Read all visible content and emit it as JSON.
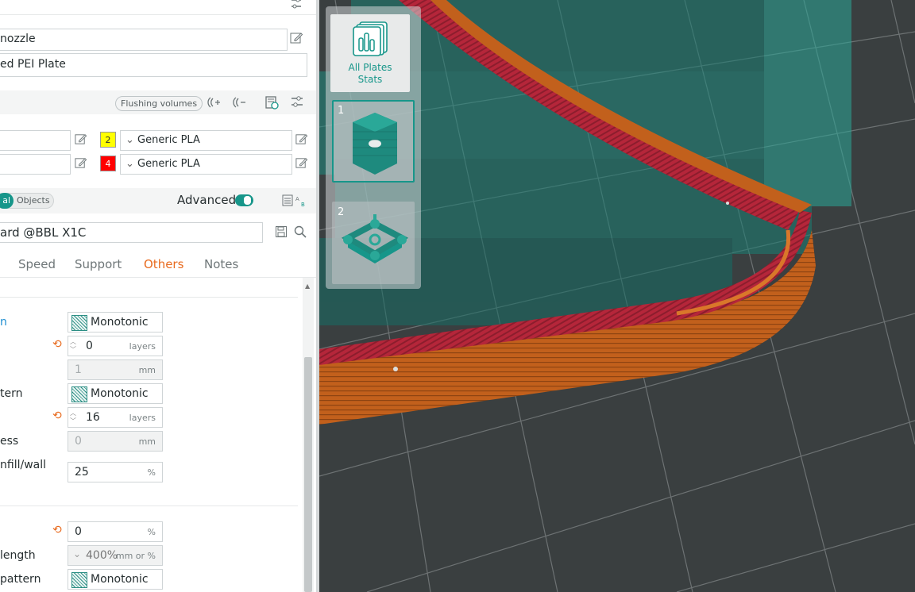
{
  "printer": {
    "nozzle_text": " nozzle",
    "plate_text": "ed PEI Plate"
  },
  "filament_header": {
    "flushing_volumes_label": "Flushing volumes"
  },
  "filaments": [
    {
      "index": "2",
      "color": "#ffff00",
      "name": "Generic PLA"
    },
    {
      "index": "4",
      "color": "#ff0000",
      "name": "Generic PLA"
    }
  ],
  "process": {
    "global_label": "al",
    "objects_label": "Objects",
    "advanced_label": "Advanced",
    "preset_name": "ard @BBL X1C"
  },
  "tabs": [
    {
      "label": "Speed",
      "active": false
    },
    {
      "label": "Support",
      "active": false
    },
    {
      "label": "Others",
      "active": true
    },
    {
      "label": "Notes",
      "active": false
    }
  ],
  "settings": {
    "top_pattern": {
      "label": "n",
      "value": "Monotonic ..."
    },
    "top_layers": {
      "value": "0",
      "unit": "layers"
    },
    "top_thickness": {
      "value": "1",
      "unit": "mm"
    },
    "bottom_pattern": {
      "label": "tern",
      "value": "Monotonic"
    },
    "bottom_layers": {
      "value": "16",
      "unit": "layers"
    },
    "bottom_thickness": {
      "label": "ess",
      "value": "0",
      "unit": "mm"
    },
    "infill_wall_overlap": {
      "label": "nfill/wall",
      "value": "25",
      "unit": "%"
    },
    "sparse_density": {
      "label": "",
      "value": "0",
      "unit": "%"
    },
    "anchor_length": {
      "label": " length",
      "value": "400%",
      "unit": "mm or %"
    },
    "infill_pattern": {
      "label": "pattern",
      "value": "Monotonic"
    }
  },
  "viewport": {
    "all_plates_label": "All Plates\nStats",
    "plates": [
      {
        "number": "1",
        "selected": true
      },
      {
        "number": "2",
        "selected": false
      }
    ]
  },
  "colors": {
    "accent": "#00ae42",
    "teal": "#17968a",
    "orange": "#e86b1f",
    "print_orange": "#c2601c",
    "print_red": "#b5263a"
  }
}
